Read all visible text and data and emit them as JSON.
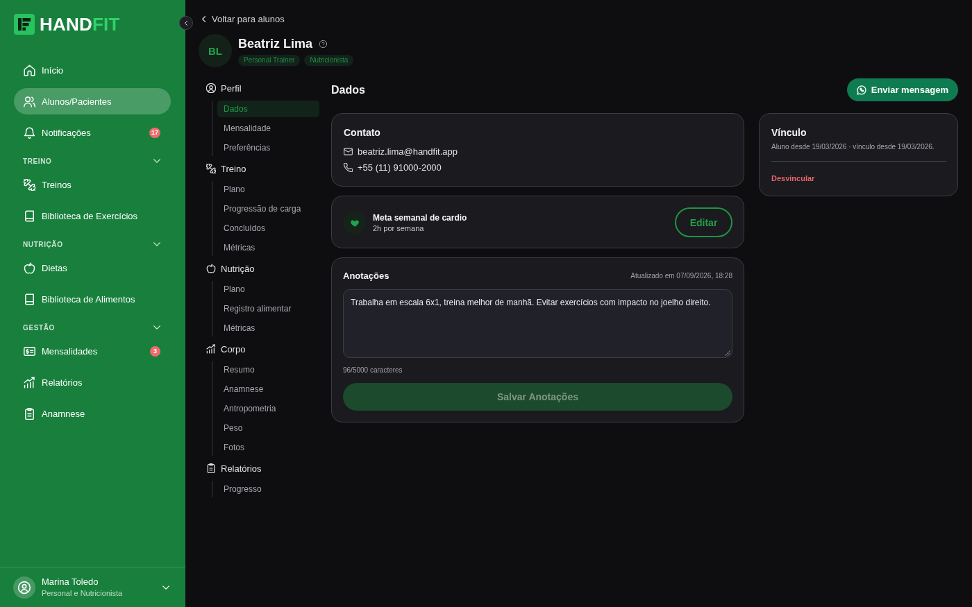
{
  "sidebar": {
    "logo": {
      "word": "HAND",
      "accent": "FIT"
    },
    "nav": [
      {
        "kind": "link",
        "label": "Início",
        "selected": false
      },
      {
        "kind": "link",
        "label": "Alunos/Pacientes",
        "selected": true
      },
      {
        "kind": "link",
        "label": "Notificações",
        "selected": false,
        "badge": "17"
      },
      {
        "kind": "section",
        "title": "TREINO",
        "expanded": true,
        "items": [
          {
            "label": "Treinos",
            "selected": false
          },
          {
            "label": "Biblioteca de Exercícios",
            "selected": false
          }
        ]
      },
      {
        "kind": "section",
        "title": "NUTRIÇÃO",
        "expanded": true,
        "items": [
          {
            "label": "Dietas",
            "selected": false
          },
          {
            "label": "Biblioteca de Alimentos",
            "selected": false
          }
        ]
      },
      {
        "kind": "section",
        "title": "GESTÃO",
        "expanded": true,
        "items": [
          {
            "label": "Mensalidades",
            "selected": false,
            "badge": "3"
          },
          {
            "label": "Relatórios",
            "selected": false
          },
          {
            "label": "Anamnese",
            "selected": false
          }
        ]
      }
    ],
    "user": {
      "name": "Marina Toledo",
      "role": "Personal e Nutricionista"
    }
  },
  "back_link": "Voltar para alunos",
  "student": {
    "initials": "BL",
    "name": "Beatriz Lima",
    "tags": [
      "Personal Trainer",
      "Nutricionista"
    ]
  },
  "profile_nav": [
    {
      "label": "Perfil",
      "children": [
        {
          "label": "Dados",
          "selected": true
        },
        {
          "label": "Mensalidade",
          "selected": false
        },
        {
          "label": "Preferências",
          "selected": false
        }
      ]
    },
    {
      "label": "Treino",
      "children": [
        {
          "label": "Plano",
          "selected": false
        },
        {
          "label": "Progressão de carga",
          "selected": false
        },
        {
          "label": "Concluídos",
          "selected": false
        },
        {
          "label": "Métricas",
          "selected": false
        }
      ]
    },
    {
      "label": "Nutrição",
      "children": [
        {
          "label": "Plano",
          "selected": false
        },
        {
          "label": "Registro alimentar",
          "selected": false
        },
        {
          "label": "Métricas",
          "selected": false
        }
      ]
    },
    {
      "label": "Corpo",
      "children": [
        {
          "label": "Resumo",
          "selected": false
        },
        {
          "label": "Anamnese",
          "selected": false
        },
        {
          "label": "Antropometria",
          "selected": false
        },
        {
          "label": "Peso",
          "selected": false
        },
        {
          "label": "Fotos",
          "selected": false
        }
      ]
    },
    {
      "label": "Relatórios",
      "children": [
        {
          "label": "Progresso",
          "selected": false
        }
      ]
    }
  ],
  "content": {
    "title": "Dados",
    "message_button": "Enviar mensagem",
    "contact": {
      "title": "Contato",
      "email": "beatriz.lima@handfit.app",
      "phone": "+55 (11) 91000-2000"
    },
    "goal": {
      "title": "Meta semanal de cardio",
      "subtitle": "2h por semana",
      "edit_button": "Editar"
    },
    "notes": {
      "title": "Anotações",
      "updated": "Atualizado em 07/09/2026, 18:28",
      "value": "Trabalha em escala 6x1, treina melhor de manhã. Evitar exercícios com impacto no joelho direito.",
      "counter": "96/5000 caracteres",
      "save_button": {
        "label": "Salvar Anotações",
        "disabled": true
      }
    },
    "link": {
      "title": "Vínculo",
      "description": "Aluno desde 19/03/2026 · vínculo desde 19/03/2026.",
      "unlink_button": "Desvincular"
    }
  }
}
